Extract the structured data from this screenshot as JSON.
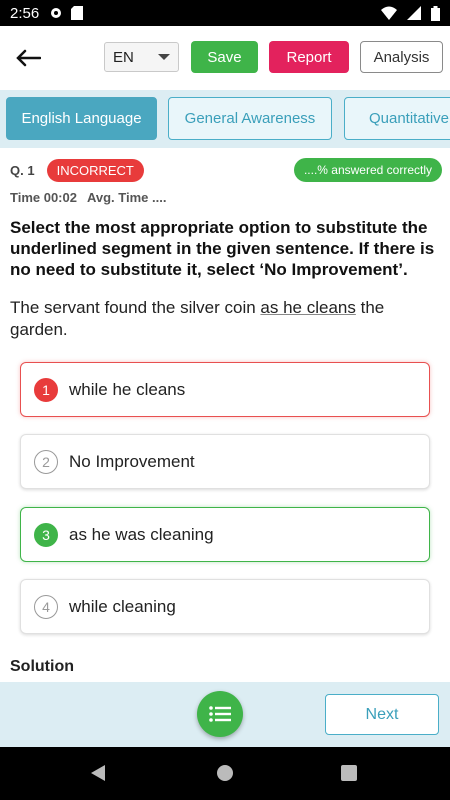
{
  "status_bar": {
    "time": "2:56",
    "icons": [
      "gear-icon",
      "sd-card-icon",
      "wifi-icon",
      "signal-icon",
      "battery-icon"
    ]
  },
  "header": {
    "language": "EN",
    "save_label": "Save",
    "report_label": "Report",
    "analysis_label": "Analysis"
  },
  "tabs": [
    {
      "label": "English Language",
      "active": true
    },
    {
      "label": "General Awareness",
      "active": false
    },
    {
      "label": "Quantitative",
      "active": false
    }
  ],
  "question": {
    "number": "Q. 1",
    "status": "INCORRECT",
    "answered_correctly": "....% answered correctly",
    "time": "Time 00:02",
    "avg_time": "Avg. Time ....",
    "text": "Select the most appropriate option to substitute the underlined segment in the given sentence. If there is no need to substitute it, select ‘No Improvement’.",
    "sentence_before": "The servant found the silver coin ",
    "sentence_underlined": "as he cleans",
    "sentence_after": " the garden."
  },
  "options": [
    {
      "number": "1",
      "text": "while he cleans",
      "state": "wrong"
    },
    {
      "number": "2",
      "text": "No Improvement",
      "state": "none"
    },
    {
      "number": "3",
      "text": "as he was cleaning",
      "state": "right"
    },
    {
      "number": "4",
      "text": "while cleaning",
      "state": "none"
    }
  ],
  "solution_label": "Solution",
  "footer": {
    "next_label": "Next"
  },
  "colors": {
    "accent": "#4aa7c0",
    "success": "#3fb449",
    "danger": "#e83b3b",
    "report": "#e3225d"
  }
}
